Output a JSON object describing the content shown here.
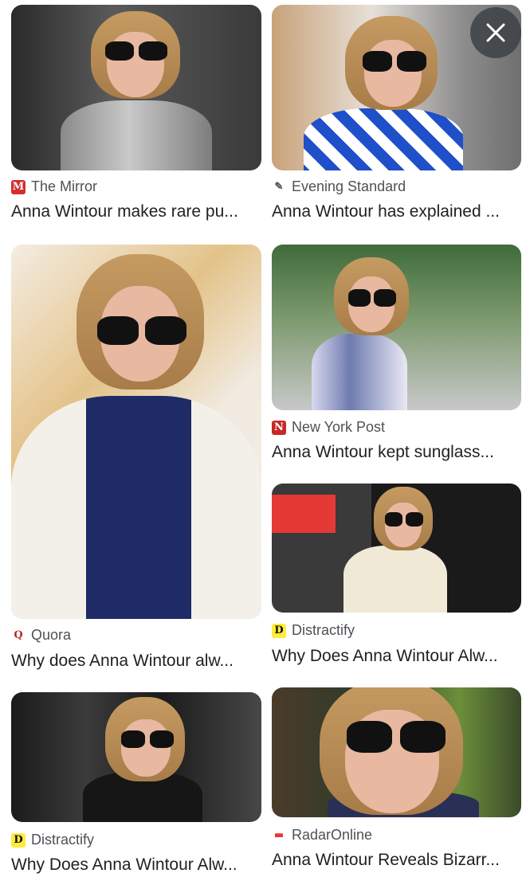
{
  "close_button": {
    "icon": "close-icon"
  },
  "results": [
    {
      "source": "The Mirror",
      "title": "Anna Wintour makes rare pu...",
      "favicon": "M",
      "favicon_bg": "#d32f2f",
      "favicon_fg": "#ffffff"
    },
    {
      "source": "Evening Standard",
      "title": "Anna Wintour has explained ...",
      "favicon": "✎",
      "favicon_bg": "#ffffff",
      "favicon_fg": "#555555"
    },
    {
      "source": "Quora",
      "title": "Why does Anna Wintour alw...",
      "favicon": "Q",
      "favicon_bg": "#ffffff",
      "favicon_fg": "#b92b27"
    },
    {
      "source": "New York Post",
      "title": "Anna Wintour kept sunglass...",
      "favicon": "N",
      "favicon_bg": "#c62828",
      "favicon_fg": "#ffffff"
    },
    {
      "source": "Distractify",
      "title": "Why Does Anna Wintour Alw...",
      "favicon": "D",
      "favicon_bg": "#ffeb3b",
      "favicon_fg": "#111111"
    },
    {
      "source": "Distractify",
      "title": "Why Does Anna Wintour Alw...",
      "favicon": "D",
      "favicon_bg": "#ffeb3b",
      "favicon_fg": "#111111"
    },
    {
      "source": "RadarOnline",
      "title": "Anna Wintour Reveals Bizarr...",
      "favicon": "▬",
      "favicon_bg": "#ffffff",
      "favicon_fg": "#e53935"
    }
  ]
}
